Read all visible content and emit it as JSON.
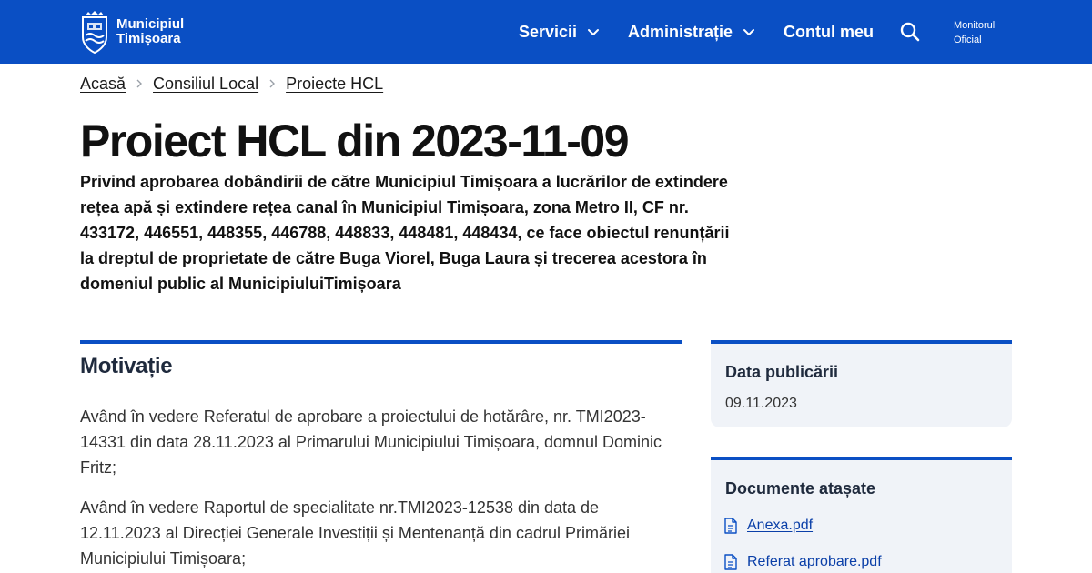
{
  "header": {
    "logo_line1": "Municipiul",
    "logo_line2": "Timișoara",
    "nav": [
      {
        "label": "Servicii",
        "has_dropdown": true
      },
      {
        "label": "Administrație",
        "has_dropdown": true
      },
      {
        "label": "Contul meu",
        "has_dropdown": false
      }
    ],
    "search_icon": "search-icon",
    "monitor_line1": "Monitorul",
    "monitor_line2": "Oficial",
    "brand_color": "#0a4fc4"
  },
  "breadcrumb": [
    "Acasă",
    "Consiliul Local",
    "Proiecte HCL"
  ],
  "page": {
    "title": "Proiect HCL din 2023-11-09",
    "subtitle": "Privind aprobarea dobândirii de către Municipiul Timișoara a lucrărilor de extindere rețea apă și extindere rețea canal în Municipiul Timișoara, zona Metro II, CF nr. 433172, 446551, 448355, 446788, 448833, 448481, 448434, ce face obiectul renunțării la dreptul de proprietate de către Buga Viorel, Buga Laura și trecerea acestora în domeniul public al MunicipiuluiTimișoara"
  },
  "motivation": {
    "title": "Motivație",
    "paragraphs": [
      "Având în vedere Referatul de aprobare a proiectului de hotărâre, nr. TMI2023-14331 din data 28.11.2023 al Primarului Municipiului Timișoara, domnul Dominic Fritz;",
      "Având în vedere Raportul de specialitate nr.TMI2023-12538 din data de 12.11.2023 al Direcției Generale Investiții și Mentenanță din cadrul Primăriei Municipiului Timișoara;"
    ]
  },
  "publication": {
    "title": "Data publicării",
    "date": "09.11.2023"
  },
  "documents": {
    "title": "Documente atașate",
    "items": [
      "Anexa.pdf",
      "Referat aprobare.pdf"
    ]
  }
}
